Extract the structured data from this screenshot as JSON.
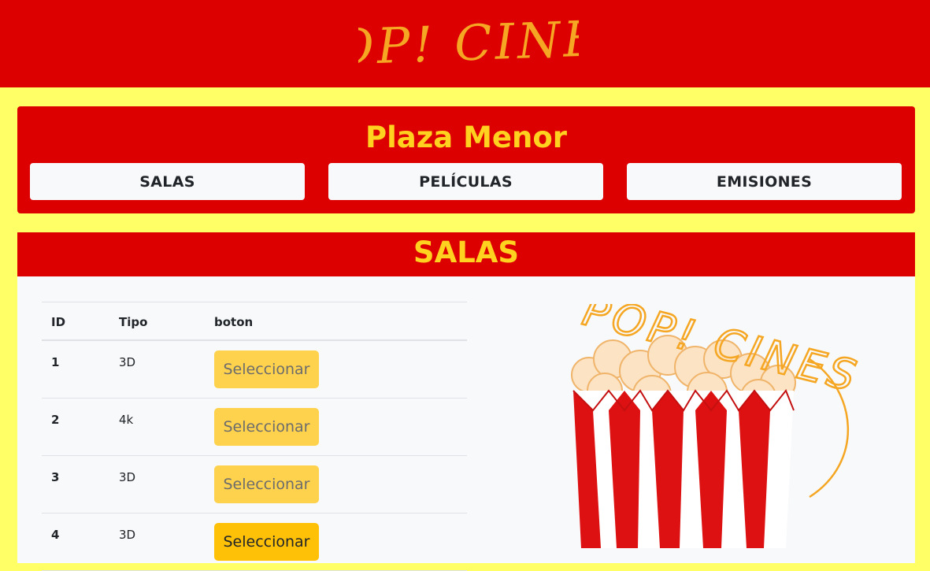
{
  "header": {
    "logo_text": "POP! CINES"
  },
  "cinema": {
    "name": "Plaza Menor",
    "nav": [
      {
        "label": "SALAS"
      },
      {
        "label": "PELÍCULAS"
      },
      {
        "label": "EMISIONES"
      }
    ]
  },
  "section": {
    "title": "SALAS",
    "table": {
      "columns": [
        "ID",
        "Tipo",
        "boton"
      ],
      "rows": [
        {
          "id": "1",
          "tipo": "3D",
          "button": "Seleccionar"
        },
        {
          "id": "2",
          "tipo": "4k",
          "button": "Seleccionar"
        },
        {
          "id": "3",
          "tipo": "3D",
          "button": "Seleccionar"
        },
        {
          "id": "4",
          "tipo": "3D",
          "button": "Seleccionar"
        }
      ]
    },
    "illustration": {
      "logo_text": "POP! CINES",
      "icon": "popcorn-bucket-icon"
    }
  },
  "colors": {
    "page_background": "#ffff66",
    "brand_red": "#dd0000",
    "title_yellow": "#ffd21f",
    "logo_orange": "#f5a623",
    "button_yellow": "#ffd24e",
    "button_yellow_active": "#ffc107"
  }
}
